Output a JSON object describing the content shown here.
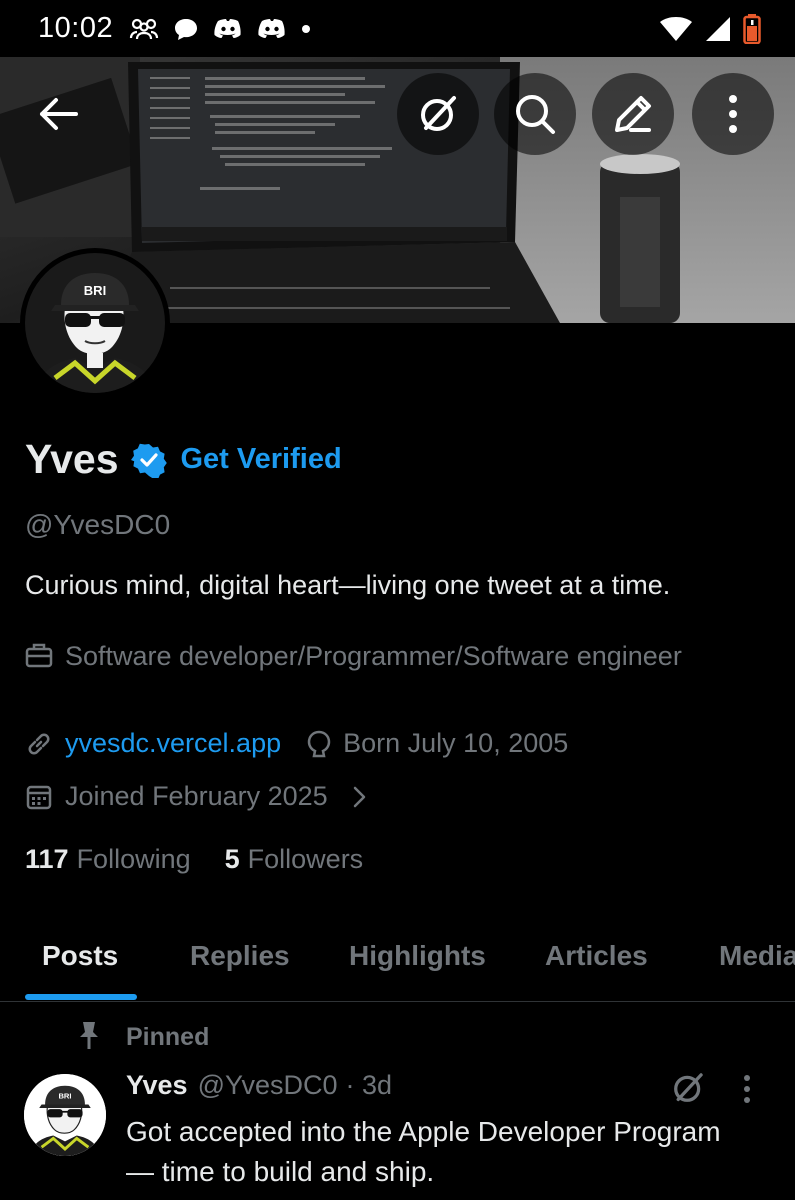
{
  "status_bar": {
    "time": "10:02",
    "icons": [
      "people-icon",
      "chat-bubble-icon",
      "discord-icon",
      "discord-icon",
      "dot-icon",
      "wifi-icon",
      "signal-icon",
      "battery-icon"
    ],
    "battery_color": "#e85a2c"
  },
  "header": {
    "back_icon": "back-arrow-icon",
    "actions": [
      "grok-icon",
      "search-icon",
      "edit-icon",
      "more-vertical-icon"
    ]
  },
  "profile": {
    "avatar_text": "BRI",
    "name": "Yves",
    "get_verified": "Get Verified",
    "handle": "@YvesDC0",
    "bio": "Curious mind, digital heart—living one tweet at a time.",
    "job": "Software developer/Programmer/Software engineer",
    "link": "yvesdc.vercel.app",
    "born": "Born July 10, 2005",
    "joined": "Joined February 2025",
    "following_count": "117",
    "following_label": "Following",
    "followers_count": "5",
    "followers_label": "Followers"
  },
  "tabs": [
    {
      "label": "Posts",
      "active": true
    },
    {
      "label": "Replies",
      "active": false
    },
    {
      "label": "Highlights",
      "active": false
    },
    {
      "label": "Articles",
      "active": false
    },
    {
      "label": "Media",
      "active": false
    }
  ],
  "pinned_post": {
    "pinned_label": "Pinned",
    "author_name": "Yves",
    "author_handle": "@YvesDC0",
    "time": "· 3d",
    "text": "Got accepted into the Apple Developer Program — time to build and ship.",
    "avatar_text": "BRI"
  },
  "colors": {
    "accent": "#1d9bf0",
    "muted": "#71767b",
    "text": "#e7e9ea",
    "background": "#000000"
  }
}
